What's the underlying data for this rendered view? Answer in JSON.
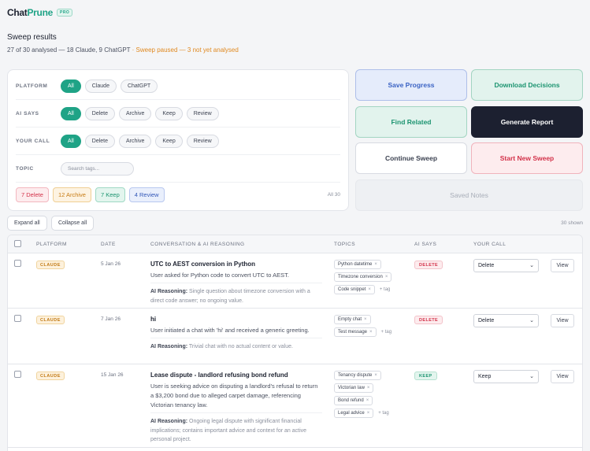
{
  "brand": {
    "name_a": "Chat",
    "name_b": "Prune",
    "badge": "PRO"
  },
  "header": {
    "title": "Sweep results",
    "summary_main": "27 of 30 analysed — 18 Claude, 9 ChatGPT",
    "summary_warn": " · Sweep paused — 3 not yet analysed"
  },
  "filters": {
    "platform": {
      "label": "PLATFORM",
      "options": [
        "All",
        "Claude",
        "ChatGPT"
      ],
      "selected": "All"
    },
    "ai_says": {
      "label": "AI SAYS",
      "options": [
        "All",
        "Delete",
        "Archive",
        "Keep",
        "Review"
      ],
      "selected": "All"
    },
    "your_call": {
      "label": "YOUR CALL",
      "options": [
        "All",
        "Delete",
        "Archive",
        "Keep",
        "Review"
      ],
      "selected": "All"
    },
    "topic": {
      "label": "TOPIC",
      "placeholder": "Search tags..."
    },
    "counts": {
      "delete": "7 Delete",
      "archive": "12 Archive",
      "keep": "7 Keep",
      "review": "4 Review",
      "all": "All 30"
    }
  },
  "actions": {
    "save": "Save Progress",
    "download": "Download Decisions",
    "find": "Find Related",
    "generate": "Generate Report",
    "continue": "Continue Sweep",
    "start": "Start New Sweep",
    "notes": "Saved Notes"
  },
  "list_controls": {
    "expand": "Expand all",
    "collapse": "Collapse all",
    "shown": "30 shown"
  },
  "table": {
    "headers": {
      "platform": "PLATFORM",
      "date": "DATE",
      "conversation": "CONVERSATION & AI REASONING",
      "topics": "TOPICS",
      "ai_says": "AI SAYS",
      "your_call": "YOUR CALL"
    },
    "reason_label": "AI Reasoning:",
    "add_tag": "+ tag",
    "view_label": "View",
    "rows": [
      {
        "platform": "CLAUDE",
        "date": "5 Jan 26",
        "title": "UTC to AEST conversion in Python",
        "desc": "User asked for Python code to convert UTC to AEST.",
        "reason": "Single question about timezone conversion with a direct code answer; no ongoing value.",
        "topics": [
          "Python datetime",
          "Timezone conversion",
          "Code snippet"
        ],
        "ai_says": "DELETE",
        "your_call": "Delete"
      },
      {
        "platform": "CLAUDE",
        "date": "7 Jan 26",
        "title": "hi",
        "desc": "User initiated a chat with 'hi' and received a generic greeting.",
        "reason": "Trivial chat with no actual content or value.",
        "topics": [
          "Empty chat",
          "Test message"
        ],
        "ai_says": "DELETE",
        "your_call": "Delete"
      },
      {
        "platform": "CLAUDE",
        "date": "15 Jan 26",
        "title": "Lease dispute - landlord refusing bond refund",
        "desc": "User is seeking advice on disputing a landlord's refusal to return a $3,200 bond due to alleged carpet damage, referencing Victorian tenancy law.",
        "reason": "Ongoing legal dispute with significant financial implications; contains important advice and context for an active personal project.",
        "topics": [
          "Tenancy dispute",
          "Victorian law",
          "Bond refund",
          "Legal advice"
        ],
        "ai_says": "KEEP",
        "your_call": "Keep"
      }
    ]
  },
  "colors": {
    "accent": "#1fa386",
    "delete": "#d3324a",
    "archive": "#c77b14",
    "keep": "#1c9470",
    "review": "#3458b8",
    "dark": "#1c2030"
  }
}
